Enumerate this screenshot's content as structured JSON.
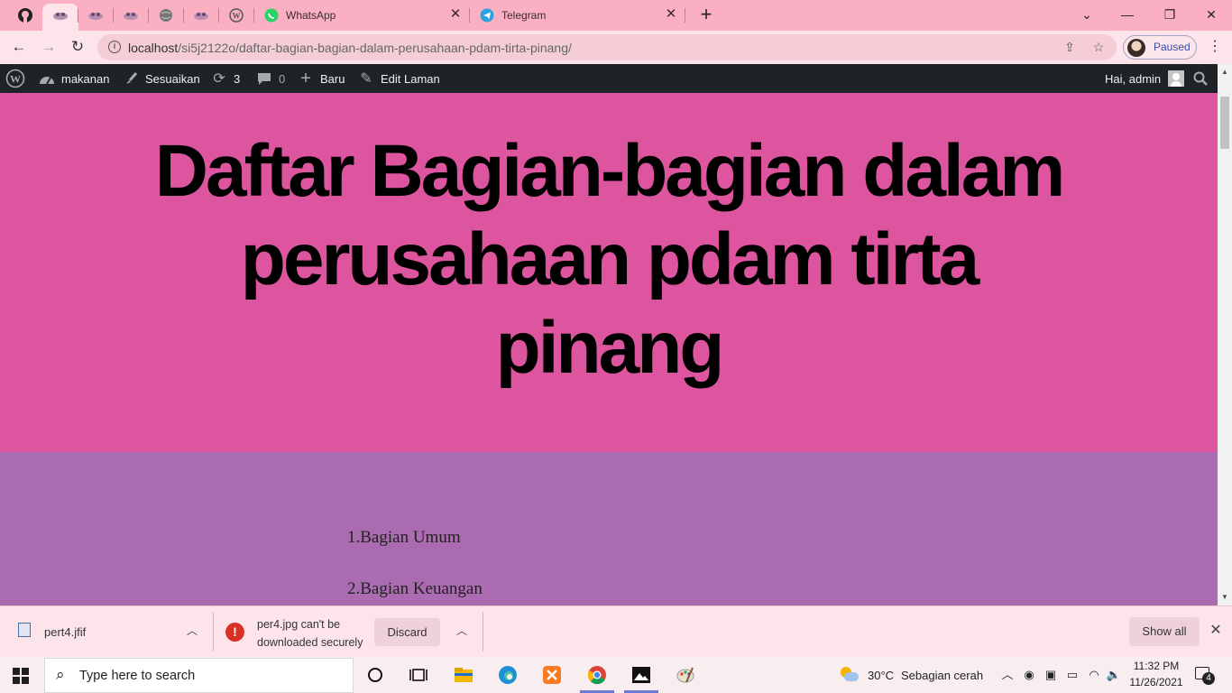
{
  "browser": {
    "tabs": [
      {
        "icon": "github-icon"
      },
      {
        "icon": "site-favicon-icon",
        "active": true
      },
      {
        "icon": "site-favicon-icon"
      },
      {
        "icon": "site-favicon-icon"
      },
      {
        "icon": "globe-icon"
      },
      {
        "icon": "site-favicon-icon"
      },
      {
        "icon": "wordpress-icon"
      },
      {
        "icon": "whatsapp-icon",
        "title": "WhatsApp"
      },
      {
        "icon": "telegram-icon",
        "title": "Telegram"
      }
    ],
    "url_host": "localhost",
    "url_path": "/si5j2122o/daftar-bagian-bagian-dalam-perusahaan-pdam-tirta-pinang/",
    "profile_label": "Paused"
  },
  "admin_bar": {
    "site_name": "makanan",
    "customize_label": "Sesuaikan",
    "updates_count": "3",
    "comments_count": "0",
    "new_label": "Baru",
    "edit_label": "Edit Laman",
    "greeting": "Hai, admin"
  },
  "page": {
    "title": "Daftar Bagian-bagian dalam perusahaan pdam tirta pinang",
    "items": [
      "1.Bagian Umum",
      "2.Bagian Keuangan"
    ]
  },
  "downloads": {
    "file1": "pert4.jfif",
    "file2_line1": "per4.jpg can't be",
    "file2_line2": "downloaded securely",
    "discard_label": "Discard",
    "show_all_label": "Show all"
  },
  "taskbar": {
    "search_placeholder": "Type here to search",
    "weather_temp": "30°C",
    "weather_desc": "Sebagian cerah",
    "time": "11:32 PM",
    "date": "11/26/2021",
    "notification_count": "4"
  },
  "colors": {
    "tabstrip": "#fab0c2",
    "toolbar": "#fde4ea",
    "hero": "#dd559e",
    "content": "#ab6bb0",
    "adminbar": "#1d2327"
  }
}
